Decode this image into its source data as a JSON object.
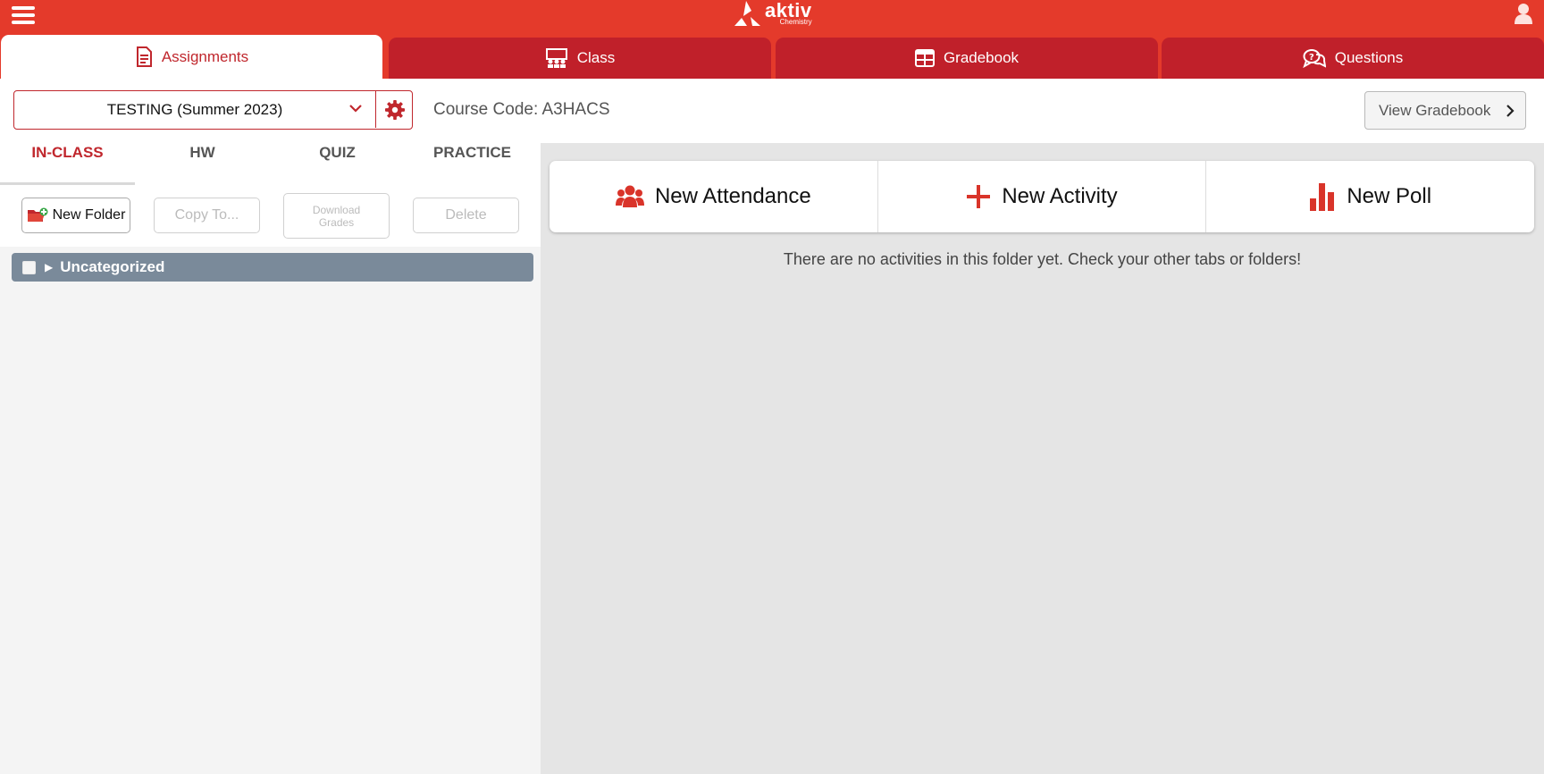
{
  "header": {
    "logo_word": "aktiv",
    "logo_sub": "Chemistry",
    "icons": {
      "menu": "hamburger-menu-icon",
      "user": "user-icon"
    }
  },
  "tabs": [
    {
      "label": "Assignments",
      "icon": "document-icon",
      "active": true
    },
    {
      "label": "Class",
      "icon": "classroom-icon",
      "active": false
    },
    {
      "label": "Gradebook",
      "icon": "table-icon",
      "active": false
    },
    {
      "label": "Questions",
      "icon": "question-chat-icon",
      "active": false
    }
  ],
  "course": {
    "selected": "TESTING (Summer 2023)",
    "code_text": "Course Code: A3HACS"
  },
  "view_gradebook_label": "View Gradebook",
  "subtabs": [
    {
      "label": "IN-CLASS",
      "active": true
    },
    {
      "label": "HW",
      "active": false
    },
    {
      "label": "QUIZ",
      "active": false
    },
    {
      "label": "PRACTICE",
      "active": false
    }
  ],
  "toolbar": {
    "new_folder": "New Folder",
    "copy_to": "Copy To...",
    "download_grades_line1": "Download",
    "download_grades_line2": "Grades",
    "delete": "Delete"
  },
  "folders": [
    {
      "name": "Uncategorized"
    }
  ],
  "actions": {
    "attendance": "New Attendance",
    "activity": "New Activity",
    "poll": "New Poll"
  },
  "empty_message": "There are no activities in this folder yet. Check your other tabs or folders!",
  "colors": {
    "brand_red": "#e43a2b",
    "tab_red": "#c0202a",
    "accent_red": "#c0272d",
    "folder_gray": "#7a8a9a"
  }
}
